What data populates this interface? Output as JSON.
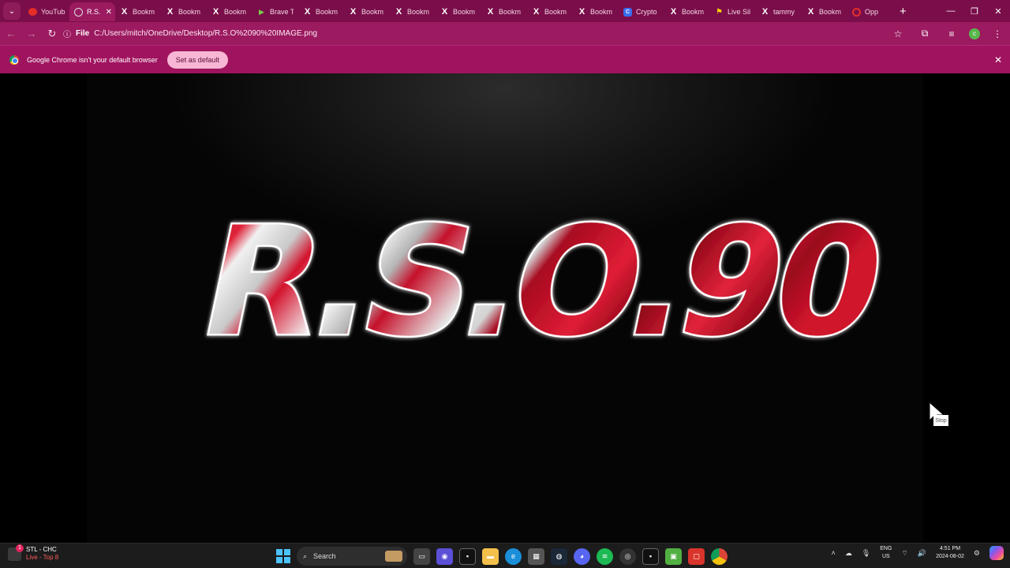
{
  "browser": {
    "tabs": [
      {
        "title": "YouTub",
        "icon": "youtube-icon",
        "active": false
      },
      {
        "title": "R.S.",
        "icon": "globe-icon",
        "active": true
      },
      {
        "title": "Bookm",
        "icon": "x-icon",
        "active": false
      },
      {
        "title": "Bookm",
        "icon": "x-icon",
        "active": false
      },
      {
        "title": "Bookm",
        "icon": "x-icon",
        "active": false
      },
      {
        "title": "Brave T",
        "icon": "brave-icon",
        "active": false
      },
      {
        "title": "Bookm",
        "icon": "x-icon",
        "active": false
      },
      {
        "title": "Bookm",
        "icon": "x-icon",
        "active": false
      },
      {
        "title": "Bookm",
        "icon": "x-icon",
        "active": false
      },
      {
        "title": "Bookm",
        "icon": "x-icon",
        "active": false
      },
      {
        "title": "Bookm",
        "icon": "x-icon",
        "active": false
      },
      {
        "title": "Bookm",
        "icon": "x-icon",
        "active": false
      },
      {
        "title": "Bookm",
        "icon": "x-icon",
        "active": false
      },
      {
        "title": "Crypto",
        "icon": "crypto-icon",
        "active": false
      },
      {
        "title": "Bookm",
        "icon": "x-icon",
        "active": false
      },
      {
        "title": "Live Sil",
        "icon": "live-icon",
        "active": false
      },
      {
        "title": "tammy",
        "icon": "x-icon",
        "active": false
      },
      {
        "title": "Bookm",
        "icon": "x-icon",
        "active": false
      },
      {
        "title": "Opp",
        "icon": "opera-icon",
        "active": false
      }
    ],
    "address": {
      "scheme": "File",
      "url": "C:/Users/mitch/OneDrive/Desktop/R.S.O%2090%20IMAGE.png"
    },
    "infobar": {
      "message": "Google Chrome isn't your default browser",
      "button": "Set as default"
    },
    "profile_initial": "c"
  },
  "image": {
    "logo_text": "R.S.O.90"
  },
  "cursor_tooltip": "Stop",
  "taskbar": {
    "widget": {
      "title": "STL - CHC",
      "subtitle": "Live - Top 8",
      "badge": "1"
    },
    "search_placeholder": "Search",
    "tray": {
      "lang_top": "ENG",
      "lang_bottom": "US",
      "time": "4:51 PM",
      "date": "2024-08-02"
    }
  },
  "colors": {
    "tabstrip": "#7a0e4a",
    "toolbar": "#9b1a60",
    "infobar": "#a0135f",
    "logo_red": "#d0102a",
    "logo_white": "#e8e8e8"
  }
}
